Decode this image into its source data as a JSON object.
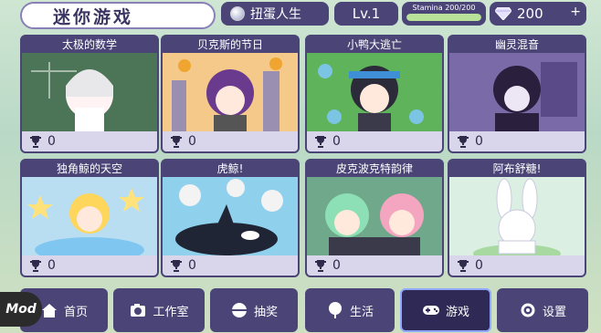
{
  "header": {
    "title": "迷你游戏",
    "gacha_label": "扭蛋人生",
    "level": "Lv.1",
    "stamina_text": "Stamina 200/200",
    "stamina_fraction": 1.0,
    "gems": "200",
    "plus": "+"
  },
  "games": [
    {
      "title": "太极的数学",
      "score": "0",
      "bg": "#8aa88a"
    },
    {
      "title": "贝克斯的节日",
      "score": "0",
      "bg": "#f2c98a"
    },
    {
      "title": "小鸭大逃亡",
      "score": "0",
      "bg": "#6fbf6a"
    },
    {
      "title": "幽灵混音",
      "score": "0",
      "bg": "#8a7bb8"
    },
    {
      "title": "独角鲸的天空",
      "score": "0",
      "bg": "#bfe0f4"
    },
    {
      "title": "虎鲸!",
      "score": "0",
      "bg": "#8fd0ec"
    },
    {
      "title": "皮克波克特韵律",
      "score": "0",
      "bg": "#7fb39a"
    },
    {
      "title": "阿布舒糖!",
      "score": "0",
      "bg": "#dcefe3"
    }
  ],
  "nav": [
    {
      "label": "首页",
      "icon": "home-icon"
    },
    {
      "label": "工作室",
      "icon": "camera-icon"
    },
    {
      "label": "抽奖",
      "icon": "gacha-icon"
    },
    {
      "label": "生活",
      "icon": "tree-icon"
    },
    {
      "label": "游戏",
      "icon": "gamepad-icon",
      "active": true
    },
    {
      "label": "设置",
      "icon": "gear-icon"
    }
  ],
  "mod_badge": "Mod"
}
